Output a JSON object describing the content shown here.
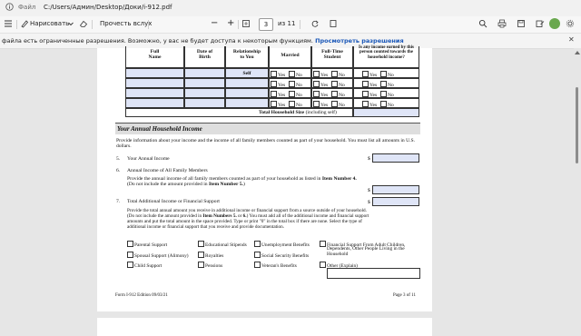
{
  "address_bar": {
    "label": "Файл",
    "path": "C:/Users/Админ/Desktop/Доки/i-912.pdf"
  },
  "toolbar": {
    "draw_label": "Нарисовать",
    "read_aloud_label": "Прочесть вслух",
    "zoom_out": "−",
    "zoom_in": "+",
    "page_current": "3",
    "page_total": "из 11"
  },
  "info_bar": {
    "message": "файла есть ограниченные разрешения. Возможно, у вас не будет доступа к некоторым функциям.",
    "link": "Просмотреть разрешения",
    "close": "✕"
  },
  "form": {
    "table_header": {
      "full_name": "Full\nName",
      "dob": "Date of\nBirth",
      "relationship": "Relationship\nto You",
      "married": "Married",
      "student": "Full-Time\nStudent",
      "income": "Is any income earned by this\nperson counted towards the\nhousehold income?"
    },
    "row1_relationship": "Self",
    "yes": "Yes",
    "no": "No",
    "household_size_label": "Total Household Size",
    "household_size_note": "(including self)",
    "section_title": "Your Annual Household Income",
    "intro": "Provide information about your income and the income of all family members counted as part of your household.  You must list all amounts in U.S. dollars.",
    "item5_num": "5.",
    "item5_label": "Your Annual Income",
    "item6_num": "6.",
    "item6_label": "Annual Income of All Family Members",
    "item6_desc_a": "Provide the annual income of all family members counted as part of your household as listed in",
    "item6_desc_b": "Item Number 4.",
    "item6_desc_c": "(Do not include the amount provided in",
    "item6_desc_d": "Item Number 5.",
    "item6_desc_e": ")",
    "item7_num": "7.",
    "item7_label": "Total Additional Income or Financial Support",
    "item7_desc_1": "Provide the total annual amount you receive in additional income or financial support from a source outside of your household.",
    "item7_desc_2a": "(Do not include the amount provided in",
    "item7_desc_2b": "Item Numbers 5.",
    "item7_desc_2c": "or",
    "item7_desc_2d": "6.",
    "item7_desc_2e": ") You must add all of the additional income and financial support",
    "item7_desc_3": "amounts and put the total amount in the space provided. Type or print \"0\" in the total box if there are none. Select the type of",
    "item7_desc_4": "additional income or financial support that you receive and provide documentation.",
    "dollar": "$",
    "checkboxes": {
      "col1": [
        "Parental Support",
        "Spousal Support (Alimony)",
        "Child Support"
      ],
      "col2": [
        "Educational Stipends",
        "Royalties",
        "Pensions"
      ],
      "col3": [
        "Unemployment Benefits",
        "Social Security Benefits",
        "Veteran's Benefits"
      ],
      "col4a": "Financial Support From Adult Children,",
      "col4b": "Dependents, Other People Living in the",
      "col4c": "Household",
      "col4d": "Other (Explain)"
    },
    "footer_left": "Form I-912  Edition  09/03/21",
    "footer_right": "Page 3 of 11"
  },
  "colors": {
    "link": "#1a57b8",
    "field_fill": "#dfe5f7",
    "section_bar": "#dedede"
  }
}
